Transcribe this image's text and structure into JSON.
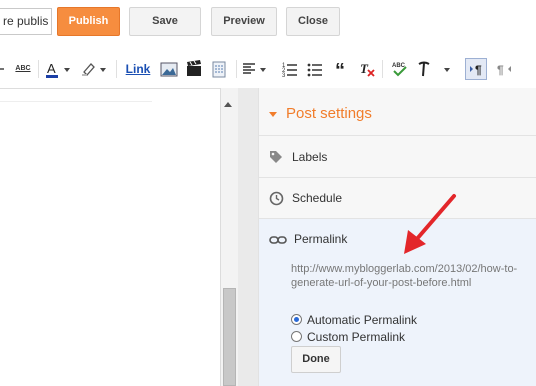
{
  "topbar": {
    "title_value": "re publis",
    "publish_label": "Publish",
    "save_label": "Save",
    "preview_label": "Preview",
    "close_label": "Close"
  },
  "toolbar": {
    "spell_label": "ABC",
    "link_label": "Link",
    "spell_check_label": "ABC",
    "icons": [
      "strikethrough-icon",
      "spellcheck-icon",
      "font-color-icon",
      "dropdown-arrow-icon",
      "highlight-icon",
      "dropdown-arrow-icon",
      "link-button",
      "image-icon",
      "video-icon",
      "jump-break-icon",
      "align-icon",
      "dropdown-arrow-icon",
      "numbered-list-icon",
      "bulleted-list-icon",
      "quote-icon",
      "clear-formatting-icon",
      "spellcheck-icon",
      "input-tools-icon",
      "dropdown-arrow-icon",
      "ltr-icon",
      "rtl-icon"
    ]
  },
  "sidebar": {
    "header": "Post settings",
    "labels": "Labels",
    "schedule": "Schedule",
    "permalink": {
      "title": "Permalink",
      "url": "http://www.mybloggerlab.com/2013/02/how-to-generate-url-of-your-post-before.html",
      "option_auto": "Automatic Permalink",
      "option_custom": "Custom Permalink",
      "selected": "Automatic Permalink",
      "done": "Done"
    }
  },
  "colors": {
    "accent": "#f17d2b",
    "publish": "#f68d3f",
    "annotation_arrow": "#e3262a",
    "permalink_bg": "#eef3fb"
  }
}
